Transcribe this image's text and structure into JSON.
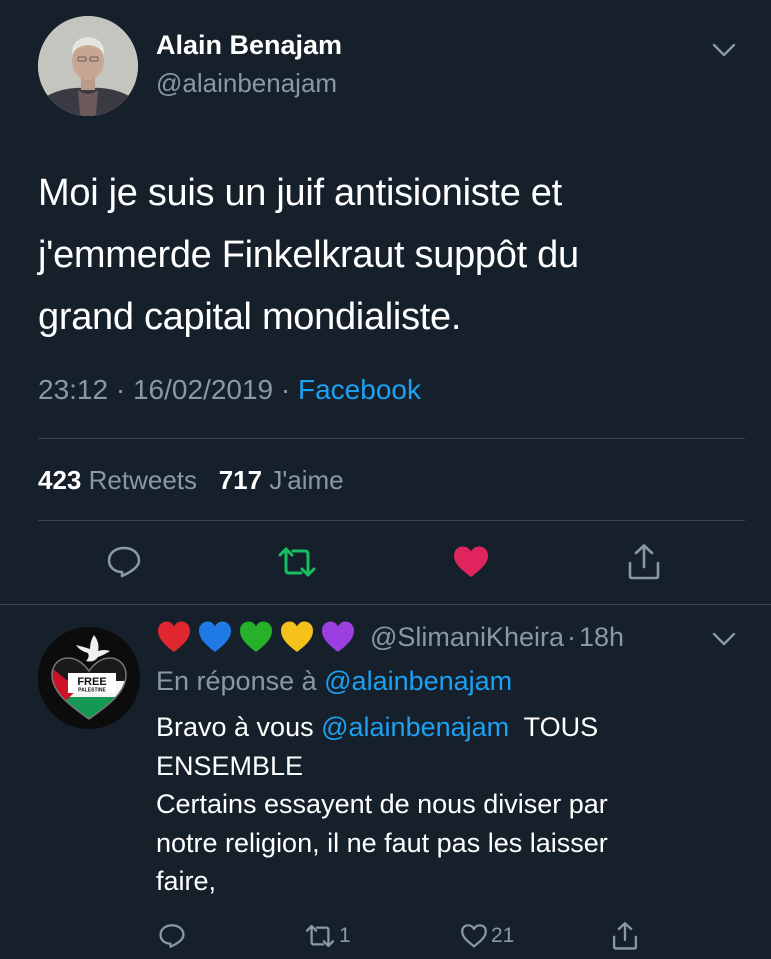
{
  "tweet": {
    "author_name": "Alain Benajam",
    "author_handle": "@alainbenajam",
    "text_lines": [
      "Moi je suis un juif antisioniste et",
      "j'emmerde Finkelkraut suppôt du",
      "grand capital mondialiste."
    ],
    "time": "23:12",
    "date": "16/02/2019",
    "separator": "·",
    "source": "Facebook",
    "retweet_count": "423",
    "retweet_label": "Retweets",
    "like_count": "717",
    "like_label": "J'aime",
    "liked": true,
    "colors": {
      "like": "#e0245e",
      "retweet": "#17bf63",
      "link": "#1da1f2"
    }
  },
  "reply": {
    "heart_emojis": [
      "red-heart",
      "blue-heart",
      "green-heart",
      "yellow-heart",
      "purple-heart"
    ],
    "heart_colors": [
      "#e0262e",
      "#1f7ae6",
      "#27b12b",
      "#f5c21b",
      "#9b3fe0"
    ],
    "handle": "@SlimaniKheira",
    "time": "18h",
    "separator": "·",
    "in_reply_prefix": "En réponse à",
    "in_reply_mention": "@alainbenajam",
    "body_start": "Bravo à vous",
    "body_mention": "@alainbenajam",
    "body_after_mention": "TOUS",
    "body_lines": [
      "ENSEMBLE",
      "Certains essayent de nous diviser par",
      "notre religion, il ne faut pas les laisser",
      "faire,"
    ],
    "avatar_text": "FREE",
    "avatar_subtext": "PALESTINE",
    "retweet_count": "1",
    "like_count": "21"
  }
}
